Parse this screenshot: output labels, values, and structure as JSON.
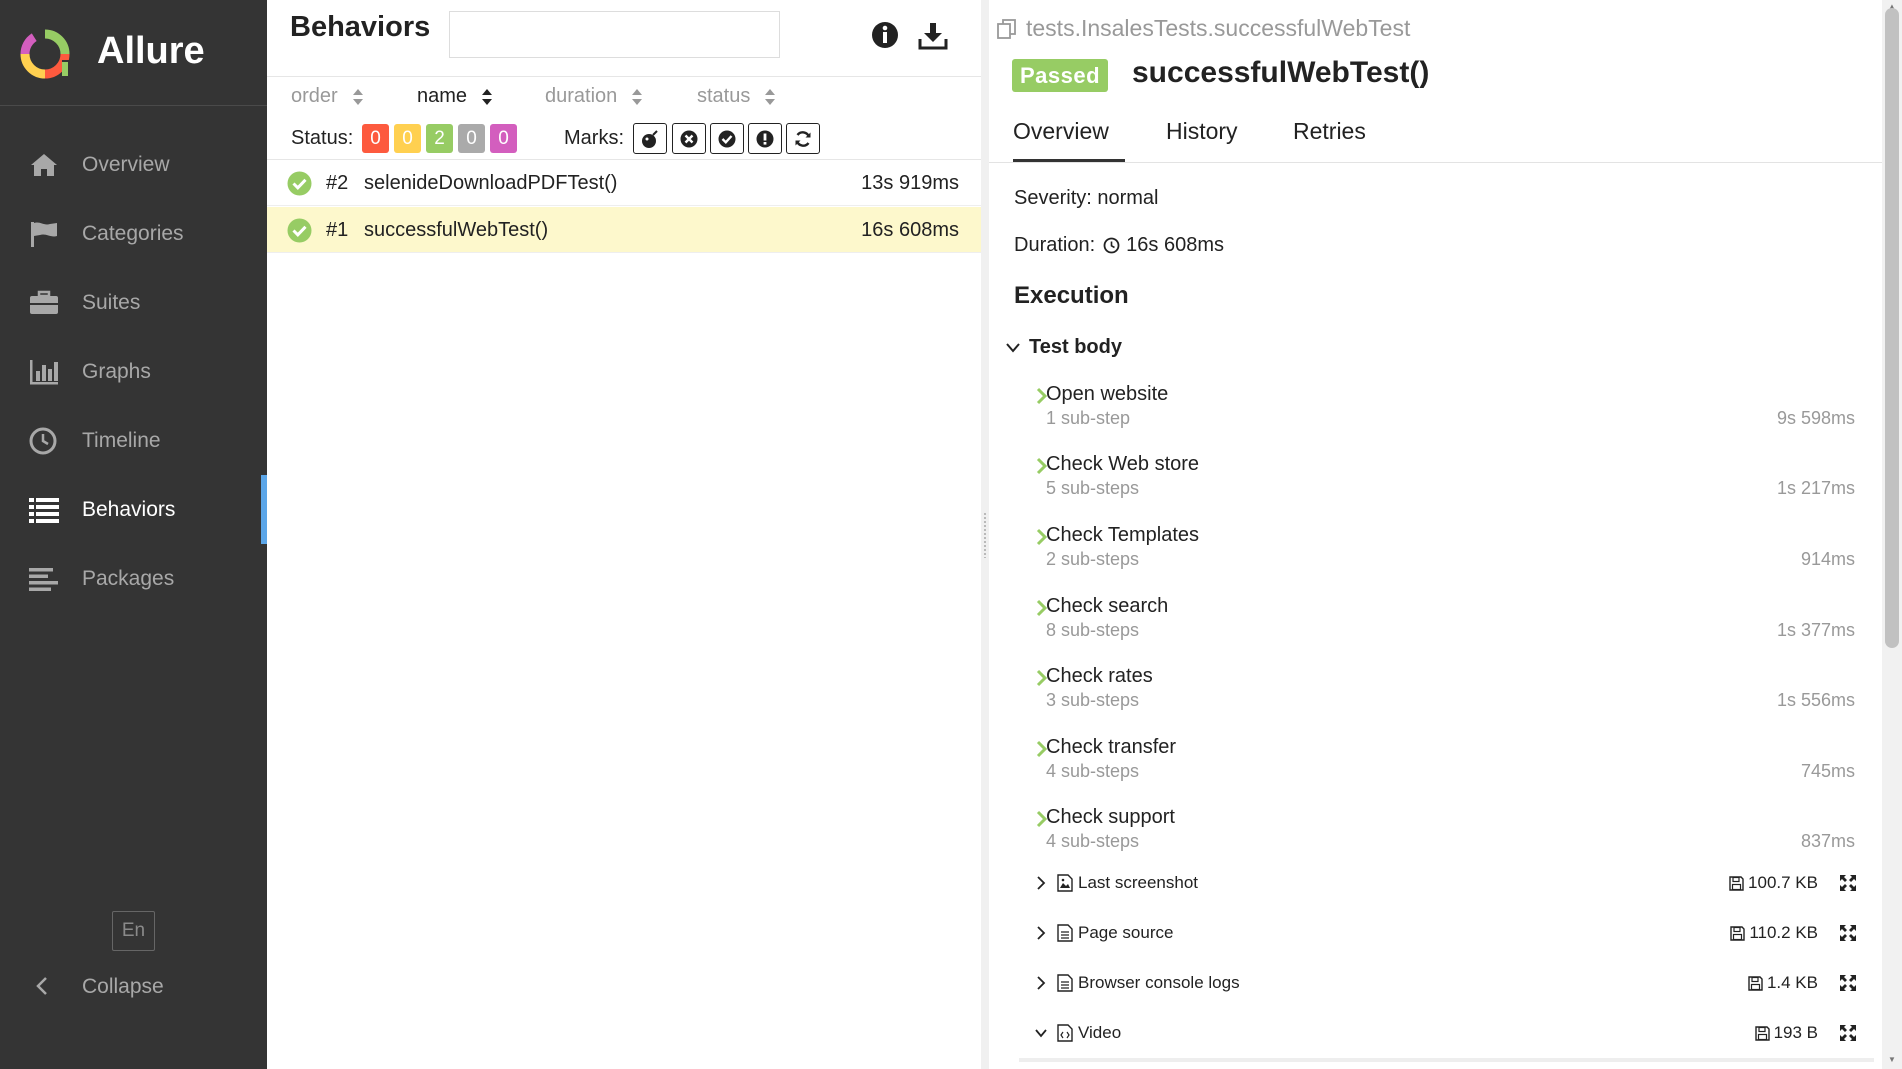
{
  "app": {
    "title": "Allure"
  },
  "sidebar": {
    "items": [
      {
        "label": "Overview",
        "icon": "home-icon"
      },
      {
        "label": "Categories",
        "icon": "flag-icon"
      },
      {
        "label": "Suites",
        "icon": "briefcase-icon"
      },
      {
        "label": "Graphs",
        "icon": "bar-chart-icon"
      },
      {
        "label": "Timeline",
        "icon": "clock-icon"
      },
      {
        "label": "Behaviors",
        "icon": "list-icon",
        "active": true
      },
      {
        "label": "Packages",
        "icon": "align-left-icon"
      }
    ],
    "language": "En",
    "collapse_label": "Collapse"
  },
  "tree": {
    "title": "Behaviors",
    "search": {
      "value": "",
      "placeholder": ""
    },
    "sort": [
      {
        "label": "order"
      },
      {
        "label": "name",
        "active": true
      },
      {
        "label": "duration"
      },
      {
        "label": "status"
      }
    ],
    "status_label": "Status:",
    "status_counts": [
      {
        "status": "failed",
        "count": "0",
        "color": "#fd5a3e"
      },
      {
        "status": "broken",
        "count": "0",
        "color": "#ffd050"
      },
      {
        "status": "passed",
        "count": "2",
        "color": "#97cc64"
      },
      {
        "status": "skipped",
        "count": "0",
        "color": "#aaaaaa"
      },
      {
        "status": "unknown",
        "count": "0",
        "color": "#d35ebe"
      }
    ],
    "marks_label": "Marks:",
    "marks": [
      "flaky-icon",
      "new-failed-icon",
      "new-passed-icon",
      "new-broken-icon",
      "retries-icon"
    ],
    "rows": [
      {
        "num": "#2",
        "name": "selenideDownloadPDFTest()",
        "duration": "13s 919ms",
        "status": "passed"
      },
      {
        "num": "#1",
        "name": "successfulWebTest()",
        "duration": "16s 608ms",
        "status": "passed",
        "selected": true
      }
    ]
  },
  "testcase": {
    "breadcrumb": "tests.InsalesTests.successfulWebTest",
    "status_badge": "Passed",
    "title": "successfulWebTest()",
    "tabs": [
      {
        "label": "Overview",
        "active": true
      },
      {
        "label": "History"
      },
      {
        "label": "Retries"
      }
    ],
    "severity_text": "Severity: normal",
    "duration_label": "Duration:",
    "duration_value": "16s 608ms",
    "execution_title": "Execution",
    "test_body_label": "Test body",
    "steps": [
      {
        "name": "Open website",
        "sub": "1 sub-step",
        "duration": "9s 598ms"
      },
      {
        "name": "Check Web store",
        "sub": "5 sub-steps",
        "duration": "1s 217ms"
      },
      {
        "name": "Check Templates",
        "sub": "2 sub-steps",
        "duration": "914ms"
      },
      {
        "name": "Check search",
        "sub": "8 sub-steps",
        "duration": "1s 377ms"
      },
      {
        "name": "Check rates",
        "sub": "3 sub-steps",
        "duration": "1s 556ms"
      },
      {
        "name": "Check transfer",
        "sub": "4 sub-steps",
        "duration": "745ms"
      },
      {
        "name": "Check support",
        "sub": "4 sub-steps",
        "duration": "837ms"
      }
    ],
    "attachments": [
      {
        "name": "Last screenshot",
        "size": "100.7 KB",
        "icon": "image-file-icon",
        "expanded": false
      },
      {
        "name": "Page source",
        "size": "110.2 KB",
        "icon": "text-file-icon",
        "expanded": false
      },
      {
        "name": "Browser console logs",
        "size": "1.4 KB",
        "icon": "text-file-icon",
        "expanded": false
      },
      {
        "name": "Video",
        "size": "193 B",
        "icon": "code-file-icon",
        "expanded": true
      }
    ]
  },
  "colors": {
    "passed": "#97cc64",
    "sidebar_bg": "#343434",
    "active_accent": "#5ca6e8",
    "selected_row": "#fdf8cc"
  }
}
